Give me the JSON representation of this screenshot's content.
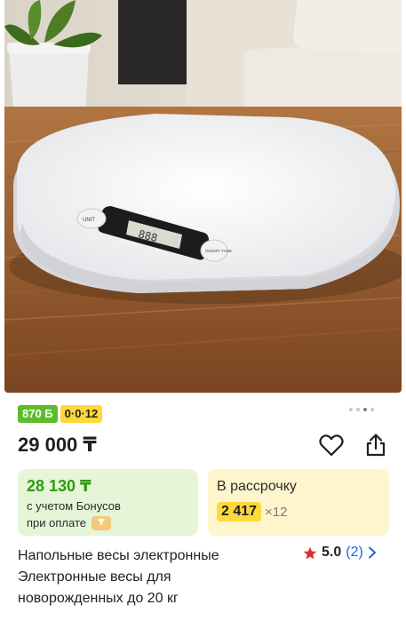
{
  "product": {
    "image_alt": "Детские электронные весы",
    "scale_button_left": "UNIT",
    "scale_button_right": "ON/OFF TARE",
    "carousel_total": 4,
    "carousel_active": 2
  },
  "badges": {
    "bonus": "870 Б",
    "installment": "0·0·12"
  },
  "price": {
    "value": "29 000 ₸"
  },
  "bonus_card": {
    "price": "28 130 ₸",
    "line1": "с учетом Бонусов",
    "line2": "при оплате"
  },
  "credit_card": {
    "title": "В рассрочку",
    "amount": "2 417",
    "months": "×12"
  },
  "title": {
    "line1": "Напольные весы электронные",
    "line2": "Электронные весы для",
    "line3": "новорожденных до 20 кг"
  },
  "rating": {
    "value": "5.0",
    "count": "(2)"
  },
  "colors": {
    "bonus_green": "#5cbd2a",
    "installment_yellow": "#ffd83b",
    "link_blue": "#1a64e0",
    "star_red": "#e32b2b"
  }
}
